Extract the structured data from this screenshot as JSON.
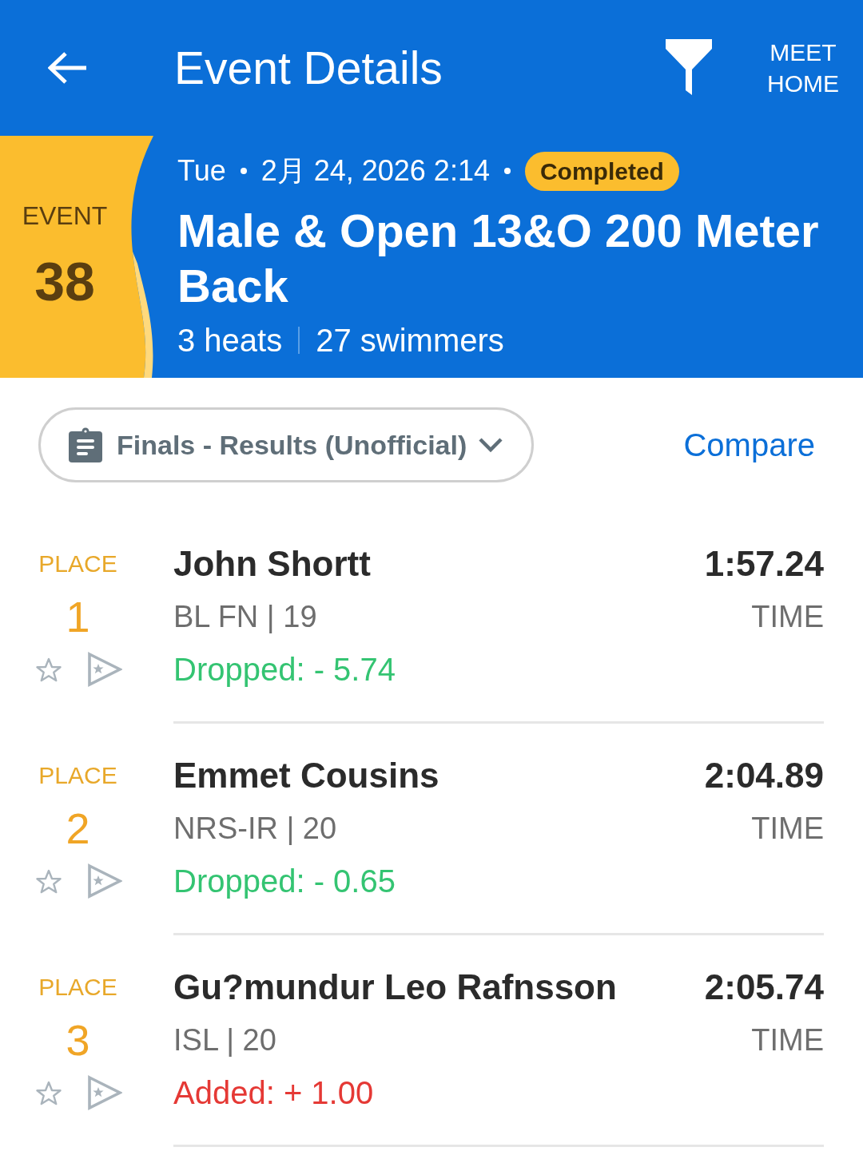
{
  "app_bar": {
    "title": "Event Details",
    "meet_home": "MEET HOME"
  },
  "event": {
    "label": "EVENT",
    "number": "38",
    "day": "Tue",
    "date": "2月 24, 2026 2:14",
    "status": "Completed",
    "title": "Male & Open 13&O 200 Meter Back",
    "heats": "3 heats",
    "swimmers": "27 swimmers"
  },
  "controls": {
    "session": "Finals - Results (Unofficial)",
    "compare": "Compare"
  },
  "results": [
    {
      "place_label": "PLACE",
      "place": "1",
      "name": "John Shortt",
      "team_age": "BL FN | 19",
      "change": {
        "kind": "dropped",
        "text": "Dropped: - 5.74"
      },
      "time": "1:57.24",
      "time_label": "TIME"
    },
    {
      "place_label": "PLACE",
      "place": "2",
      "name": "Emmet Cousins",
      "team_age": "NRS-IR | 20",
      "change": {
        "kind": "dropped",
        "text": "Dropped: - 0.65"
      },
      "time": "2:04.89",
      "time_label": "TIME"
    },
    {
      "place_label": "PLACE",
      "place": "3",
      "name": "Gu?mundur Leo Rafnsson",
      "team_age": "ISL | 20",
      "change": {
        "kind": "added",
        "text": "Added: + 1.00"
      },
      "time": "2:05.74",
      "time_label": "TIME"
    }
  ]
}
